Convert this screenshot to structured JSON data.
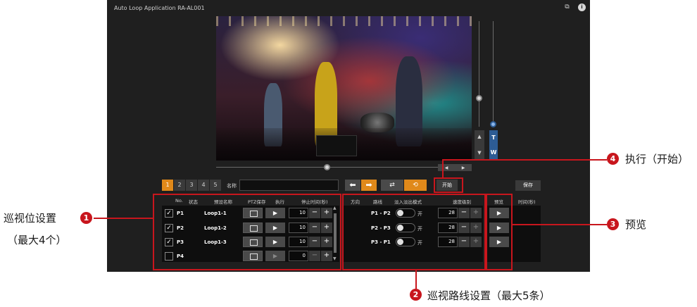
{
  "app_title": "Auto Loop Application RA-AL001",
  "titlebar_icons": [
    {
      "name": "feedback-icon",
      "glyph": "⧉"
    },
    {
      "name": "info-icon",
      "glyph": "i"
    }
  ],
  "camera": {
    "zoom_up_glyph": "▲",
    "zoom_down_glyph": "▼",
    "tele_label": "T",
    "wide_label": "W",
    "pan_left_glyph": "◀",
    "pan_right_glyph": "▶"
  },
  "toolbar": {
    "presets": [
      "1",
      "2",
      "3",
      "4",
      "5"
    ],
    "active_preset": "1",
    "name_label": "名称",
    "name_value": "",
    "dir_left_glyph": "⬅",
    "dir_right_glyph": "➡",
    "mode_oneway_glyph": "⇄",
    "mode_loop_glyph": "⟲",
    "start_label": "开始",
    "save_label": "保存"
  },
  "preset_table": {
    "headers": [
      "No.",
      "状态",
      "预设名称",
      "PTZ保存",
      "执行",
      "停止时间(秒)"
    ],
    "rows": [
      {
        "checked": true,
        "checkmark": "✓",
        "no": "P1",
        "name": "Loop1-1",
        "time": "10"
      },
      {
        "checked": true,
        "checkmark": "✓",
        "no": "P2",
        "name": "Loop1-2",
        "time": "10"
      },
      {
        "checked": true,
        "checkmark": "✓",
        "no": "P3",
        "name": "Loop1-3",
        "time": "10"
      },
      {
        "checked": false,
        "checkmark": "",
        "no": "P4",
        "name": "",
        "time": "0"
      }
    ],
    "minus": "−",
    "plus": "+",
    "play_glyph": "▶",
    "scroll_up": "▲",
    "scroll_down": "▼"
  },
  "route_table": {
    "headers": [
      "方向",
      "路线",
      "淡入淡出模式",
      "速度级别"
    ],
    "rows": [
      {
        "route": "P1 - P2",
        "toggle_label": "开",
        "speed": "28"
      },
      {
        "route": "P2 - P3",
        "toggle_label": "开",
        "speed": "28"
      },
      {
        "route": "P3 - P1",
        "toggle_label": "开",
        "speed": "28"
      }
    ]
  },
  "preview_table": {
    "headers": [
      "预览",
      "时间(秒)"
    ],
    "play_glyph": "▶"
  },
  "annotations": {
    "preset_settings": {
      "number": "1",
      "line1": "巡视位设置",
      "line2": "（最大4个）"
    },
    "route_settings": {
      "number": "2",
      "text": "巡视路线设置（最大5条）"
    },
    "preview": {
      "number": "3",
      "text": "预览"
    },
    "execute": {
      "number": "4",
      "text": "执行（开始）"
    }
  },
  "colors": {
    "accent": "#e0891a",
    "annotation": "#c8161d",
    "panel_bg": "#1f1f1f",
    "tw_blue": "#2d5c94"
  }
}
